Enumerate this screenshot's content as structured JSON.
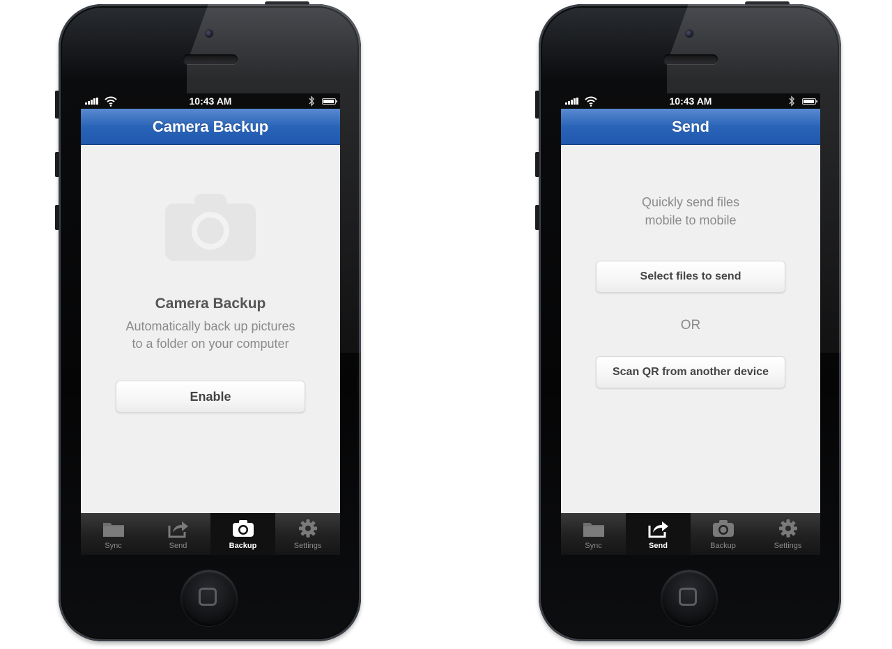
{
  "status_bar": {
    "time": "10:43 AM"
  },
  "phones": {
    "left": {
      "nav_title": "Camera Backup",
      "content": {
        "heading": "Camera Backup",
        "description_line1": "Automatically back up pictures",
        "description_line2": "to a folder on your computer",
        "enable_button": "Enable"
      },
      "active_tab": "Backup"
    },
    "right": {
      "nav_title": "Send",
      "content": {
        "intro_line1": "Quickly send files",
        "intro_line2": "mobile to mobile",
        "select_button": "Select files to send",
        "or_label": "OR",
        "scan_button": "Scan QR from another device"
      },
      "active_tab": "Send"
    }
  },
  "tabs": [
    {
      "label": "Sync",
      "icon": "folder-icon"
    },
    {
      "label": "Send",
      "icon": "share-icon"
    },
    {
      "label": "Backup",
      "icon": "camera-icon"
    },
    {
      "label": "Settings",
      "icon": "gear-icon"
    }
  ],
  "colors": {
    "nav_bar": "#2a64b8",
    "tab_bar": "#222222",
    "content_bg": "#f0f0f0"
  }
}
